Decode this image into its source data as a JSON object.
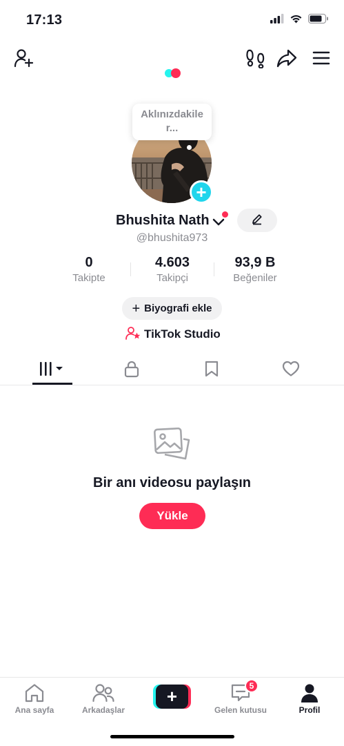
{
  "status_bar": {
    "time": "17:13",
    "icons": [
      "cellular-signal-icon",
      "wifi-icon",
      "battery-icon"
    ]
  },
  "top_nav": {
    "left_icon": "add-friend-icon",
    "right_icons": [
      "footprints-icon",
      "share-icon",
      "menu-icon"
    ]
  },
  "profile": {
    "note_placeholder": "Aklınızdakiler...",
    "note_line1": "Aklınızdakile",
    "note_line2": "r...",
    "display_name": "Bhushita Nath",
    "username": "@bhushita973",
    "stats": [
      {
        "value": "0",
        "label": "Takipte"
      },
      {
        "value": "4.603",
        "label": "Takipçi"
      },
      {
        "value": "93,9 B",
        "label": "Beğeniler"
      }
    ],
    "bio_button": "Biyografi ekle",
    "studio_link": "TikTok Studio"
  },
  "tabs": [
    {
      "id": "videos",
      "icon": "grid-icon",
      "active": true
    },
    {
      "id": "private",
      "icon": "lock-icon",
      "active": false
    },
    {
      "id": "saved",
      "icon": "bookmark-icon",
      "active": false
    },
    {
      "id": "liked",
      "icon": "heart-icon",
      "active": false
    }
  ],
  "empty_state": {
    "icon": "photo-icon",
    "title": "Bir anı videosu paylaşın",
    "button": "Yükle"
  },
  "bottom_nav": {
    "items": [
      {
        "label": "Ana sayfa",
        "icon": "home-icon",
        "active": false
      },
      {
        "label": "Arkadaşlar",
        "icon": "friends-icon",
        "active": false
      },
      {
        "label": "",
        "icon": "create-plus-icon",
        "active": false
      },
      {
        "label": "Gelen kutusu",
        "icon": "inbox-icon",
        "active": false,
        "badge": "5"
      },
      {
        "label": "Profil",
        "icon": "profile-icon",
        "active": true
      }
    ]
  },
  "colors": {
    "accent": "#fe2c55",
    "cyan": "#25f4ee",
    "text_primary": "#161823",
    "text_secondary": "#8a8b91",
    "badge_add": "#20d5ec"
  }
}
